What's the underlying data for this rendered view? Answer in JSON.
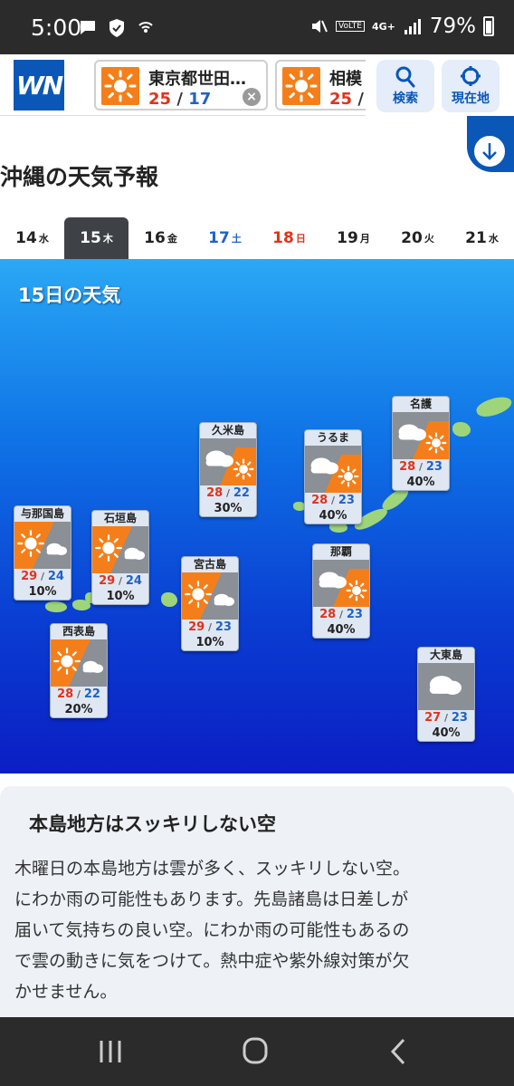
{
  "status_bar": {
    "time": "5:00",
    "network": "4G+",
    "volte": "VoLTE",
    "battery": "79%",
    "icons": [
      "chat-icon",
      "shield-check-icon",
      "wifi-calling-icon",
      "mute-icon",
      "signal-icon",
      "battery-icon"
    ]
  },
  "header": {
    "logo_text": "WN",
    "locations": [
      {
        "name": "東京都世田…",
        "high": "25",
        "low": "17",
        "icon": "sunny-icon"
      },
      {
        "name": "相模",
        "high": "25",
        "low": "",
        "icon": "sunny-icon"
      }
    ],
    "search_label": "検索",
    "current_location_label": "現在地"
  },
  "page_title": "沖縄の天気予報",
  "day_tabs": [
    {
      "day": "14",
      "dow": "水",
      "type": "normal"
    },
    {
      "day": "15",
      "dow": "木",
      "type": "active"
    },
    {
      "day": "16",
      "dow": "金",
      "type": "normal"
    },
    {
      "day": "17",
      "dow": "土",
      "type": "sat"
    },
    {
      "day": "18",
      "dow": "日",
      "type": "sun"
    },
    {
      "day": "19",
      "dow": "月",
      "type": "normal"
    },
    {
      "day": "20",
      "dow": "火",
      "type": "normal"
    },
    {
      "day": "21",
      "dow": "水",
      "type": "normal"
    }
  ],
  "map": {
    "title": "15日の天気",
    "cities": [
      {
        "name": "与那国島",
        "high": "29",
        "low": "24",
        "pop": "10%",
        "weather": "sunny-then-cloudy"
      },
      {
        "name": "石垣島",
        "high": "29",
        "low": "24",
        "pop": "10%",
        "weather": "sunny-then-cloudy"
      },
      {
        "name": "西表島",
        "high": "28",
        "low": "22",
        "pop": "20%",
        "weather": "sunny-then-cloudy"
      },
      {
        "name": "宮古島",
        "high": "29",
        "low": "23",
        "pop": "10%",
        "weather": "sunny-then-cloudy"
      },
      {
        "name": "久米島",
        "high": "28",
        "low": "22",
        "pop": "30%",
        "weather": "cloudy-then-sunny"
      },
      {
        "name": "うるま",
        "high": "28",
        "low": "23",
        "pop": "40%",
        "weather": "cloudy-then-sunny"
      },
      {
        "name": "名護",
        "high": "28",
        "low": "23",
        "pop": "40%",
        "weather": "cloudy-then-sunny"
      },
      {
        "name": "那覇",
        "high": "28",
        "low": "23",
        "pop": "40%",
        "weather": "cloudy-then-sunny"
      },
      {
        "name": "大東島",
        "high": "27",
        "low": "23",
        "pop": "40%",
        "weather": "cloudy"
      }
    ]
  },
  "summary": {
    "title": "本島地方はスッキリしない空",
    "lines": [
      "木曜日の本島地方は雲が多く、スッキリしない空。",
      "にわか雨の可能性もあります。先島諸島は日差しが",
      "届いて気持ちの良い空。にわか雨の可能性もあるの",
      "で雲の動きに気をつけて。熱中症や紫外線対策が欠",
      "かせません。"
    ]
  },
  "colors": {
    "brand_blue": "#0a57b8",
    "sun_orange": "#f47f1a",
    "high_red": "#e2321b",
    "low_blue": "#1f63c6"
  }
}
